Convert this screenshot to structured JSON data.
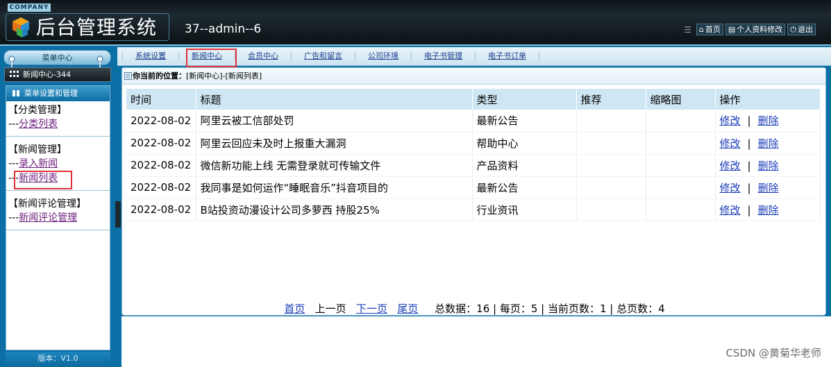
{
  "header": {
    "company": "COMPANY",
    "system_title": "后台管理系统",
    "user_info": "37--admin--6",
    "links": [
      {
        "label": "首页",
        "icon": "home-icon"
      },
      {
        "label": "个人资料修改",
        "icon": "profile-icon"
      },
      {
        "label": "退出",
        "icon": "power-icon"
      }
    ]
  },
  "sidebar": {
    "title": "菜单中心",
    "current_module": "新闻中心-344",
    "section_title": "菜单设置和管理",
    "groups": [
      {
        "title": "【分类管理】",
        "links": [
          {
            "prefix": "---",
            "label": "分类列表"
          }
        ]
      },
      {
        "title": "【新闻管理】",
        "links": [
          {
            "prefix": "---",
            "label": "录入新闻"
          },
          {
            "prefix": "---",
            "label": "新闻列表"
          }
        ]
      },
      {
        "title": "【新闻评论管理】",
        "links": [
          {
            "prefix": "---",
            "label": "新闻评论管理"
          }
        ]
      }
    ],
    "version": "版本：V1.0"
  },
  "tabs": [
    "系统设置",
    "新闻中心",
    "会员中心",
    "广告和留言",
    "公司环境",
    "电子书管理",
    "电子书订单"
  ],
  "breadcrumb": {
    "label": "你当前的位置：",
    "path": "[新闻中心]-[新闻列表]"
  },
  "table": {
    "columns": [
      "时间",
      "标题",
      "类型",
      "推荐",
      "缩略图",
      "操作"
    ],
    "edit_label": "修改",
    "delete_label": "删除",
    "rows": [
      {
        "time": "2022-08-02",
        "title": "阿里云被工信部处罚",
        "type": "最新公告",
        "recommend": "",
        "thumb": ""
      },
      {
        "time": "2022-08-02",
        "title": "阿里云回应未及时上报重大漏洞",
        "type": "帮助中心",
        "recommend": "",
        "thumb": ""
      },
      {
        "time": "2022-08-02",
        "title": "微信新功能上线 无需登录就可传输文件",
        "type": "产品资料",
        "recommend": "",
        "thumb": ""
      },
      {
        "time": "2022-08-02",
        "title": "我同事是如何运作“睡眠音乐”抖音项目的",
        "type": "最新公告",
        "recommend": "",
        "thumb": ""
      },
      {
        "time": "2022-08-02",
        "title": "B站投资动漫设计公司多萝西 持股25%",
        "type": "行业资讯",
        "recommend": "",
        "thumb": ""
      }
    ]
  },
  "pager": {
    "first": "首页",
    "prev": "上一页",
    "next": "下一页",
    "last": "尾页",
    "summary": "总数据：16 | 每页：5 | 当前页数：1 | 总页数：4"
  },
  "watermark": "CSDN @黄菊华老师",
  "colors": {
    "accent": "#0b6fa6",
    "header": "#1d2a31",
    "highlight": "#e0303a",
    "link": "#1a3cb8"
  }
}
